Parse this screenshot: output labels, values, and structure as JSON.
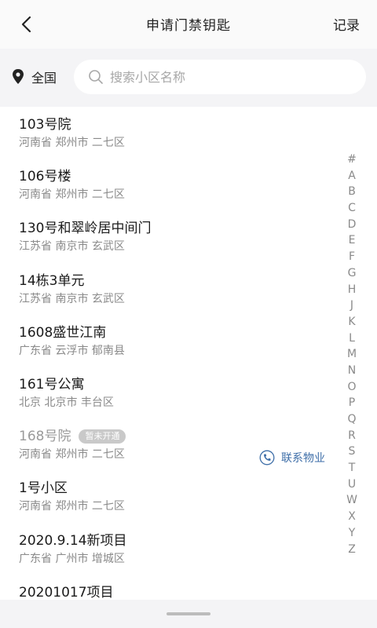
{
  "header": {
    "back_icon": "chevron-left-icon",
    "title": "申请门禁钥匙",
    "records_label": "记录"
  },
  "filter": {
    "region_icon": "location-pin-icon",
    "region_label": "全国",
    "search_icon": "search-icon",
    "search_placeholder": "搜索小区名称"
  },
  "communities": [
    {
      "name": "103号院",
      "address": "河南省 郑州市 二七区"
    },
    {
      "name": "106号楼",
      "address": "河南省 郑州市 二七区"
    },
    {
      "name": "130号和翠岭居中间门",
      "address": "江苏省 南京市 玄武区"
    },
    {
      "name": "14栋3单元",
      "address": "江苏省 南京市 玄武区"
    },
    {
      "name": "1608盛世江南",
      "address": "广东省 云浮市 郁南县"
    },
    {
      "name": "161号公寓",
      "address": "北京 北京市 丰台区"
    },
    {
      "name": "168号院",
      "address": "河南省 郑州市 二七区",
      "badge": "暂未开通",
      "contact_label": "联系物业"
    },
    {
      "name": "1号小区",
      "address": "河南省 郑州市 二七区"
    },
    {
      "name": "2020.9.14新项目",
      "address": "广东省 广州市 增城区"
    },
    {
      "name": "20201017项目",
      "address": ""
    }
  ],
  "index_letters": [
    "#",
    "A",
    "B",
    "C",
    "D",
    "E",
    "F",
    "G",
    "H",
    "J",
    "K",
    "L",
    "M",
    "N",
    "O",
    "P",
    "Q",
    "R",
    "S",
    "T",
    "U",
    "W",
    "X",
    "Y",
    "Z"
  ],
  "colors": {
    "accent": "#3e6ea8",
    "badge_bg": "#c9c9c9",
    "background": "#f4f4f6"
  }
}
